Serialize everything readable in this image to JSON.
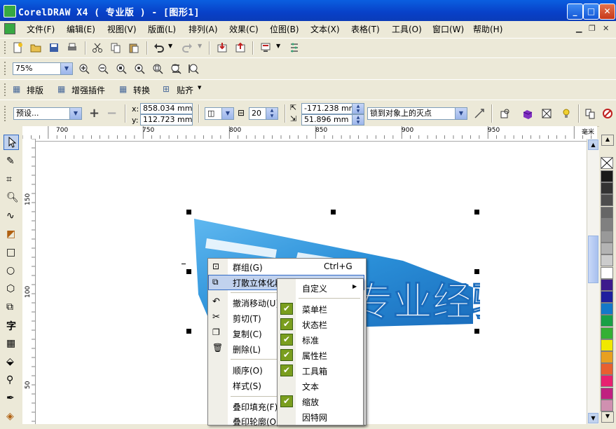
{
  "window": {
    "title": "CorelDRAW X4 ( 专业版 ) - [图形1]"
  },
  "menubar": [
    {
      "label": "文件(F)"
    },
    {
      "label": "编辑(E)"
    },
    {
      "label": "视图(V)"
    },
    {
      "label": "版面(L)"
    },
    {
      "label": "排列(A)"
    },
    {
      "label": "效果(C)"
    },
    {
      "label": "位图(B)"
    },
    {
      "label": "文本(X)"
    },
    {
      "label": "表格(T)"
    },
    {
      "label": "工具(O)"
    },
    {
      "label": "窗口(W)"
    },
    {
      "label": "帮助(H)"
    }
  ],
  "zoom": {
    "value": "75%"
  },
  "plugins_bar": {
    "items": [
      {
        "label": "排版"
      },
      {
        "label": "增强插件"
      },
      {
        "label": "转换"
      },
      {
        "label": "贴齐"
      }
    ]
  },
  "property_bar": {
    "preset": "预设...",
    "x": "858.034 mm",
    "y": "112.723 mm",
    "x_label": "x:",
    "y_label": "y:",
    "depth": "20",
    "vp_x": "-171.238 mm",
    "vp_y": "51.896 mm",
    "vanishing_point": "锁到对象上的灭点"
  },
  "ruler": {
    "h_ticks": [
      {
        "label": "700"
      },
      {
        "label": "750"
      },
      {
        "label": "800"
      },
      {
        "label": "850"
      },
      {
        "label": "900"
      },
      {
        "label": "950"
      }
    ],
    "unit": "毫米",
    "v_ticks": [
      {
        "label": "150"
      },
      {
        "label": "100"
      },
      {
        "label": "50"
      }
    ]
  },
  "context_menu": {
    "items": [
      {
        "label": "群组(G)",
        "shortcut": "Ctrl+G",
        "icon": "group-icon"
      },
      {
        "label": "打散立体化群组",
        "icon": "break-apart-icon",
        "highlighted": true
      },
      {
        "label": "撤消移动(U)",
        "icon": "undo-icon"
      },
      {
        "label": "剪切(T)",
        "icon": "scissors-icon"
      },
      {
        "label": "复制(C)",
        "icon": "copy-icon"
      },
      {
        "label": "删除(L)",
        "icon": "trash-icon"
      },
      {
        "label": "顺序(O)"
      },
      {
        "label": "样式(S)"
      },
      {
        "label": "叠印填充(F)"
      },
      {
        "label": "叠印轮廓(O)"
      }
    ]
  },
  "submenu": {
    "items": [
      {
        "label": "自定义",
        "checked": false,
        "has_arrow": true
      },
      {
        "label": "菜单栏",
        "checked": true
      },
      {
        "label": "状态栏",
        "checked": true
      },
      {
        "label": "标准",
        "checked": true
      },
      {
        "label": "属性栏",
        "checked": true
      },
      {
        "label": "工具箱",
        "checked": true
      },
      {
        "label": "文本",
        "checked": false
      },
      {
        "label": "缩放",
        "checked": true
      },
      {
        "label": "因特网",
        "checked": false
      }
    ]
  },
  "artwork": {
    "text": "专业经验"
  },
  "palette_colors": [
    "#ffffff",
    "#1a1a1a",
    "#333333",
    "#4d4d4d",
    "#666666",
    "#808080",
    "#999999",
    "#b3b3b3",
    "#cccccc",
    "#ffffff",
    "#3d1a8c",
    "#1f1f9e",
    "#1478c8",
    "#18a046",
    "#34b034",
    "#f0e800",
    "#e8a020",
    "#e86030",
    "#e82070",
    "#c02080",
    "#d090b0"
  ],
  "colors": {
    "title_bar": "#0a4fd8",
    "highlight": "#c1d2ee",
    "check": "#7a9e1e",
    "artwork_blue": "#2a8fd8"
  }
}
